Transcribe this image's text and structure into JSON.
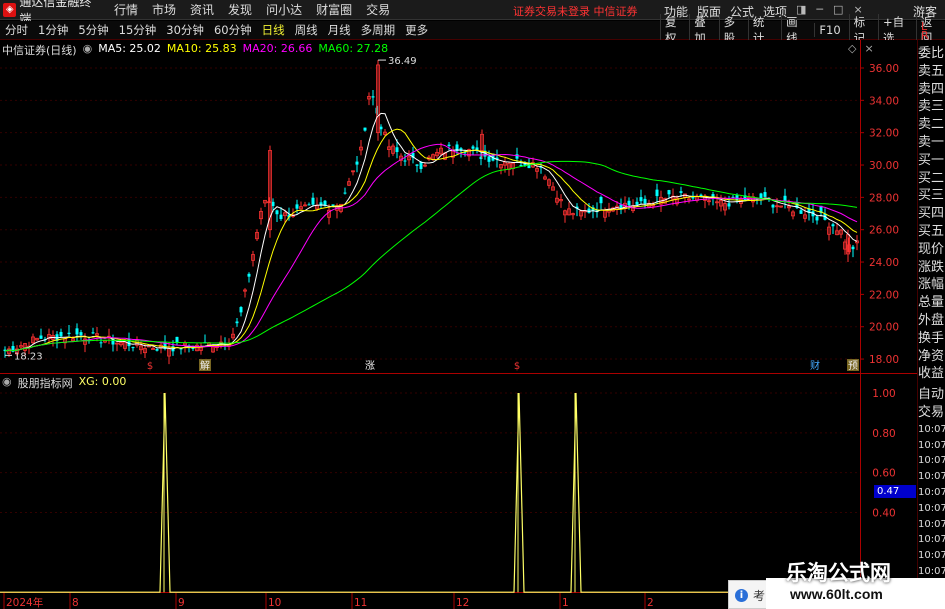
{
  "menubar": {
    "app_name": "通达信金融终端",
    "items": [
      "行情",
      "市场",
      "资讯",
      "发现",
      "问小达",
      "财富圈",
      "交易"
    ],
    "warning": "证券交易未登录  中信证券",
    "right_items": [
      "功能",
      "版面",
      "公式",
      "选项"
    ],
    "window_controls": [
      "◨",
      "─",
      "□",
      "×"
    ],
    "guest": "游客"
  },
  "period_tabs": [
    "分时",
    "1分钟",
    "5分钟",
    "15分钟",
    "30分钟",
    "60分钟",
    "日线",
    "周线",
    "月线",
    "多周期",
    "更多"
  ],
  "active_period": "日线",
  "right_buttons": [
    "复权",
    "叠加",
    "多股",
    "统计",
    "画线",
    "F10",
    "标记",
    "+自选",
    "返回"
  ],
  "main_legend": {
    "stock": "中信证券(日线)",
    "ma5": "MA5: 25.02",
    "ma10": "MA10: 25.83",
    "ma20": "MA20: 26.66",
    "ma60": "MA60: 27.28"
  },
  "ctrl_icons": [
    "◇",
    "×"
  ],
  "sub_legend": {
    "name": "股朋指标网",
    "xg": "XG: 0.00"
  },
  "price_axis": [
    "36.00",
    "34.00",
    "32.00",
    "30.00",
    "28.00",
    "26.00",
    "24.00",
    "22.00",
    "20.00",
    "18.00"
  ],
  "sub_axis": [
    "1.00",
    "0.80",
    "0.60",
    "0.40"
  ],
  "high_label": "36.49",
  "low_label": "18.23",
  "current_xg": "0.47",
  "date_axis": [
    "2024年",
    "8",
    "9",
    "10",
    "11",
    "12",
    "1",
    "2"
  ],
  "event_markers": [
    "$",
    "解",
    "涨",
    "$",
    "财",
    "预"
  ],
  "side_top": [
    "L",
    "R",
    "300"
  ],
  "side_panel": [
    "委比",
    "卖五",
    "卖四",
    "卖三",
    "卖二",
    "卖一",
    "买一",
    "买二",
    "买三",
    "买四",
    "买五",
    "现价",
    "涨跌",
    "涨幅",
    "总量",
    "外盘",
    "换手",
    "净资",
    "收益"
  ],
  "side_sub": [
    "自动",
    "交易"
  ],
  "side_times": [
    "10:07",
    "10:07",
    "10:07",
    "10:07",
    "10:07",
    "10:07",
    "10:07",
    "10:07",
    "10:07",
    "10:07"
  ],
  "popup_text": "考",
  "watermark": {
    "title": "乐淘公式网",
    "url": "www.60lt.com"
  },
  "colors": {
    "up": "#ff3232",
    "down": "#00ffff",
    "ma5": "#ffffff",
    "ma10": "#ffff00",
    "ma20": "#ff00ff",
    "ma60": "#00ff00",
    "xg": "#ffff66"
  },
  "chart_data": [
    {
      "type": "candlestick",
      "title": "中信证券(日线)",
      "x_range": [
        "2024-07",
        "2025-02"
      ],
      "ylim": [
        17.5,
        37.0
      ],
      "y_ticks": [
        18,
        20,
        22,
        24,
        26,
        28,
        30,
        32,
        34,
        36
      ],
      "series": [
        {
          "name": "MA5",
          "value": 25.02
        },
        {
          "name": "MA10",
          "value": 25.83
        },
        {
          "name": "MA20",
          "value": 26.66
        },
        {
          "name": "MA60",
          "value": 27.28
        }
      ],
      "annotations": [
        {
          "text": "36.49",
          "kind": "max"
        },
        {
          "text": "18.23",
          "kind": "min"
        }
      ]
    },
    {
      "type": "line",
      "title": "股朋指标网",
      "series": [
        {
          "name": "XG",
          "value": 0.0
        }
      ],
      "ylim": [
        0,
        1.05
      ],
      "y_ticks": [
        0.4,
        0.6,
        0.8,
        1.0
      ],
      "spikes": [
        {
          "month": "2024-09",
          "value": 1.0
        },
        {
          "month": "2025-01",
          "value": 1.0
        },
        {
          "month": "2025-01",
          "value": 1.0
        }
      ]
    }
  ]
}
